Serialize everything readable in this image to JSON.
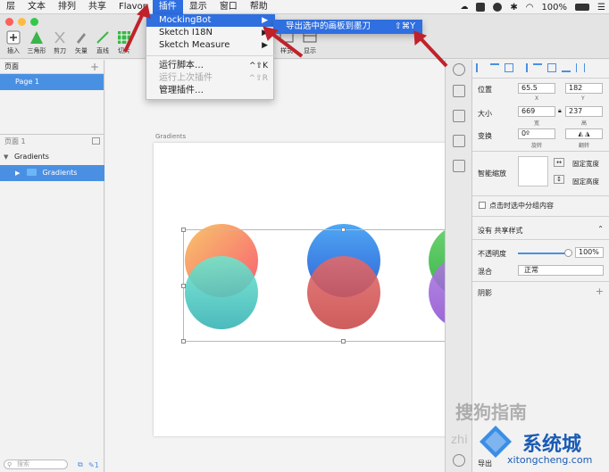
{
  "menubar": {
    "items": [
      "层",
      "文本",
      "排列",
      "共享",
      "Flavor",
      "插件",
      "显示",
      "窗口",
      "帮助"
    ],
    "right": {
      "battery": "100%"
    }
  },
  "toolbar": {
    "tools": [
      {
        "label": "插入",
        "icon": "plus-icon"
      },
      {
        "label": "三角形",
        "icon": "triangle-icon"
      },
      {
        "label": "剪刀",
        "icon": "scissors-icon"
      },
      {
        "label": "矢量",
        "icon": "vector-pen-icon"
      },
      {
        "label": "直线",
        "icon": "line-icon"
      },
      {
        "label": "切片",
        "icon": "slice-icon"
      },
      {
        "label": "样式",
        "icon": "style-icon"
      },
      {
        "label": "显示",
        "icon": "view-icon"
      }
    ]
  },
  "plugin_menu": {
    "items": [
      {
        "label": "MockingBot",
        "shortcut": "▶",
        "highlighted": true
      },
      {
        "label": "Sketch I18N",
        "shortcut": "▶"
      },
      {
        "label": "Sketch Measure",
        "shortcut": "▶"
      },
      {
        "label": "运行脚本…",
        "shortcut": "^⇧K"
      },
      {
        "label": "运行上次插件",
        "shortcut": "^⇧R",
        "disabled": true
      },
      {
        "label": "管理插件…",
        "shortcut": ""
      }
    ]
  },
  "submenu": {
    "label": "导出选中的画板到墨刀",
    "shortcut": "⇧⌘Y"
  },
  "left_panel": {
    "pages_header": "页面",
    "page_item": "Page 1",
    "layers_header": "页面 1",
    "layers": [
      {
        "label": "Gradients"
      },
      {
        "label": "Gradients"
      }
    ],
    "search_placeholder": "搜索"
  },
  "canvas": {
    "artboard_label": "Gradients"
  },
  "inspector": {
    "position": {
      "label": "位置",
      "x": "65.5",
      "y": "182",
      "x_label": "X",
      "y_label": "Y"
    },
    "size": {
      "label": "大小",
      "w": "669",
      "h": "237",
      "w_label": "宽",
      "h_label": "高"
    },
    "transform": {
      "label": "变换",
      "rotate": "0º",
      "rotate_label": "旋转",
      "flip_label": "翻转"
    },
    "resizing": {
      "label": "智能缩放",
      "fixed_width": "固定宽度",
      "fixed_height": "固定高度"
    },
    "click_through": "点击时选中分组内容",
    "shared_style": "没有 共享样式",
    "opacity": {
      "label": "不透明度",
      "value": "100%",
      "level": 1.0
    },
    "blending": {
      "label": "混合",
      "value": "正常"
    },
    "shadow": "阴影",
    "export": "导出"
  },
  "watermark": {
    "line1": "搜狗指南",
    "line2": "系统城",
    "line3": "xitongcheng.com",
    "prefix": "zhi"
  }
}
